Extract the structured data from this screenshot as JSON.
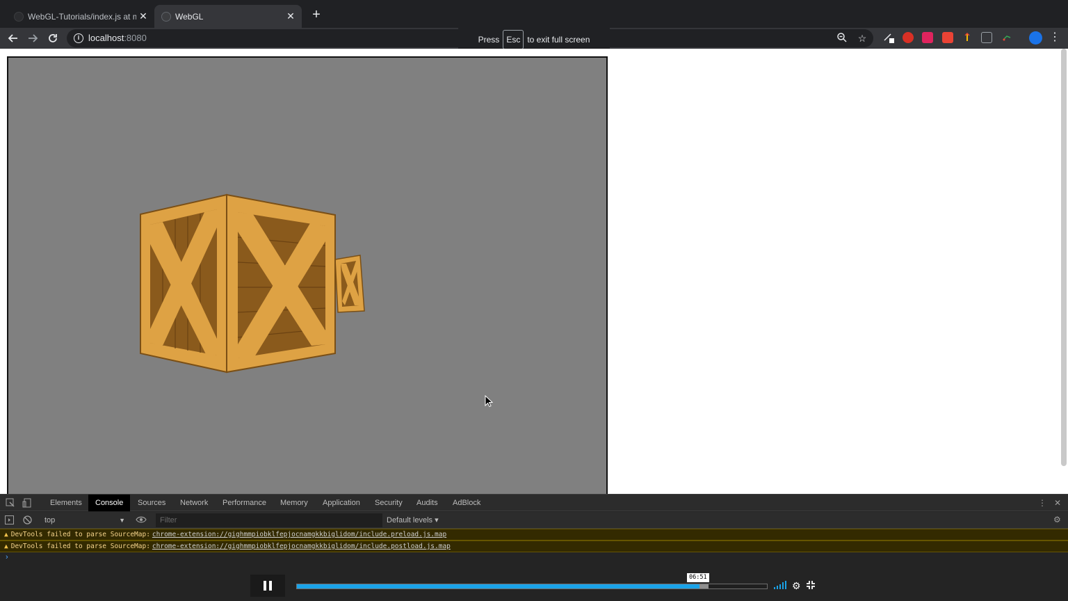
{
  "tabs": [
    {
      "title": "WebGL-Tutorials/index.js at mas",
      "close": "✕"
    },
    {
      "title": "WebGL",
      "close": "✕"
    }
  ],
  "new_tab": "+",
  "address": {
    "host": "localhost",
    "port": ":8080"
  },
  "fullscreen_bubble": {
    "press": "Press",
    "key": "Esc",
    "rest": "to exit full screen"
  },
  "devtools": {
    "tabs": [
      "Elements",
      "Console",
      "Sources",
      "Network",
      "Performance",
      "Memory",
      "Application",
      "Security",
      "Audits",
      "AdBlock"
    ],
    "active_tab": "Console",
    "context": "top",
    "filter_placeholder": "Filter",
    "levels": "Default levels ▾",
    "messages": [
      {
        "text": "DevTools failed to parse SourceMap:",
        "link": "chrome-extension://gighmmpiobklfepjocnamgkkbiglidom/include.preload.js.map"
      },
      {
        "text": "DevTools failed to parse SourceMap:",
        "link": "chrome-extension://gighmmpiobklfepjocnamgkkbiglidom/include.postload.js.map"
      }
    ],
    "prompt": "›"
  },
  "video": {
    "time": "06:51",
    "progress_played": 0.857,
    "progress_buffered": 0.876
  },
  "colors": {
    "crate_light": "#dea244",
    "crate_mid": "#c98a33",
    "crate_dark": "#8a5a1c",
    "crate_outline": "#7a4f16",
    "canvas_bg": "#808080",
    "progress": "#1aa3e8"
  }
}
